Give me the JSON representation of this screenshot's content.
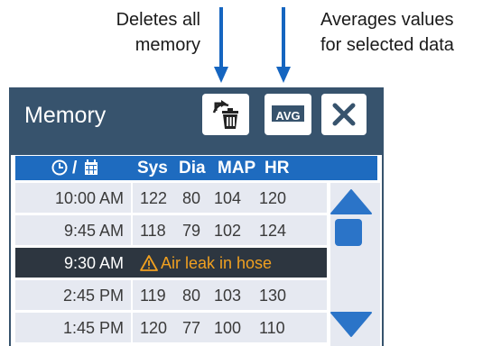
{
  "callouts": {
    "delete": {
      "line1": "Deletes all",
      "line2": "memory"
    },
    "average": {
      "line1": "Averages values",
      "line2": "for selected data"
    }
  },
  "window": {
    "title": "Memory"
  },
  "toolbar": {
    "delete_icon": "trash-can-reload-icon",
    "avg_label": "AVG",
    "close_icon": "close-x-icon"
  },
  "table": {
    "time_header_icons": [
      "clock-icon",
      "calendar-icon"
    ],
    "time_header_sep": "/",
    "columns": [
      "Sys",
      "Dia",
      "MAP",
      "HR"
    ],
    "rows": [
      {
        "time": "10:00 AM",
        "sys": "122",
        "dia": "80",
        "map": "104",
        "hr": "120"
      },
      {
        "time": "9:45 AM",
        "sys": "118",
        "dia": "79",
        "map": "102",
        "hr": "124"
      },
      {
        "time": "9:30 AM",
        "alert": "Air leak in hose",
        "alert_icon": "warning-triangle-icon"
      },
      {
        "time": "2:45 PM",
        "sys": "119",
        "dia": "80",
        "map": "103",
        "hr": "130"
      },
      {
        "time": "1:45 PM",
        "sys": "120",
        "dia": "77",
        "map": "100",
        "hr": "110"
      }
    ]
  },
  "scrollbar": {
    "up_icon": "triangle-up-icon",
    "down_icon": "triangle-down-icon"
  },
  "colors": {
    "panel": "#37536d",
    "header_row": "#1e6bbf",
    "row_bg": "#e6e9f1",
    "alert_row_bg": "#2d3640",
    "alert_text": "#f0a020",
    "arrow": "#1565c0"
  }
}
